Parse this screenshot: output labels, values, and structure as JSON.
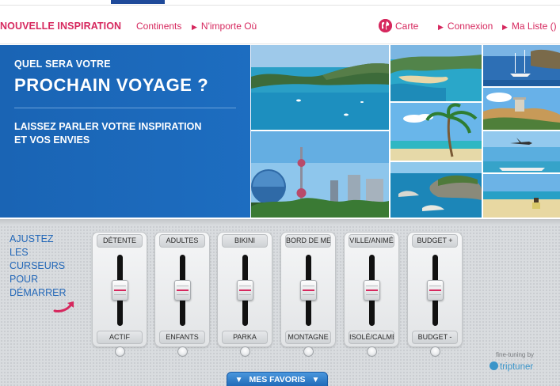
{
  "header": {
    "brand": "NOUVELLE INSPIRATION",
    "nav_left": [
      {
        "label": "Continents"
      },
      {
        "label": "N'importe Où"
      }
    ],
    "nav_right": [
      {
        "label": "Carte",
        "icon": "globe-icon"
      },
      {
        "label": "Connexion"
      },
      {
        "label": "Ma Liste ()"
      }
    ]
  },
  "hero": {
    "line1": "QUEL SERA VOTRE",
    "line2": "PROCHAIN VOYAGE ?",
    "line3": "LAISSEZ PARLER VOTRE INSPIRATION",
    "line4": "ET VOS ENVIES"
  },
  "tuner": {
    "instructions": [
      "AJUSTEZ",
      "LES",
      "CURSEURS",
      "POUR",
      "DÉMARRER"
    ],
    "sliders": [
      {
        "top": "DÉTENTE",
        "bottom": "ACTIF",
        "value": 0.5
      },
      {
        "top": "ADULTES",
        "bottom": "ENFANTS",
        "value": 0.5
      },
      {
        "top": "BIKINI",
        "bottom": "PARKA",
        "value": 0.5
      },
      {
        "top": "BORD DE MER",
        "bottom": "MONTAGNE",
        "value": 0.5
      },
      {
        "top": "VILLE/ANIMÉ",
        "bottom": "ISOLÉ/CALME",
        "value": 0.5
      },
      {
        "top": "BUDGET +",
        "bottom": "BUDGET -",
        "value": 0.5
      }
    ],
    "fine_tuning": "fine-tuning by",
    "triptuner": "triptuner",
    "favorites": "MES FAVORIS"
  },
  "colors": {
    "brand": "#d6285e",
    "hero_blue": "#1d6dc0",
    "instruction_blue": "#2468b8"
  }
}
